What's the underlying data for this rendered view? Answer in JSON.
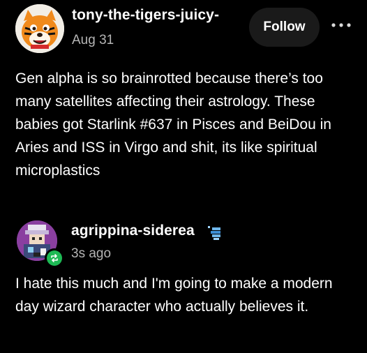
{
  "post": {
    "username": "tony-the-tigers-juicy-",
    "timestamp": "Aug 31",
    "follow_label": "Follow",
    "body": "Gen alpha is so brainrotted because there’s too many satellites affecting their astrology. These babies got Starlink #637 in Pisces and BeiDou in Aries and ISS in Virgo and shit, its like spiritual microplastics",
    "avatar_icon": "tiger-avatar-icon",
    "more_icon": "more-options-icon"
  },
  "reblog": {
    "username": "agrippina-siderea",
    "timestamp": "3s ago",
    "body": "I hate this much and I'm going to make a modern day wizard character who actually believes it.",
    "avatar_icon": "pixel-art-avatar-icon",
    "reblog_icon": "reblog-icon",
    "badge_icon": "blog-badge-icon"
  },
  "colors": {
    "background": "#000000",
    "text": "#ffffff",
    "muted": "#b5b5b5",
    "button_bg": "#1a1a1a",
    "reblog_green": "#1db954"
  }
}
